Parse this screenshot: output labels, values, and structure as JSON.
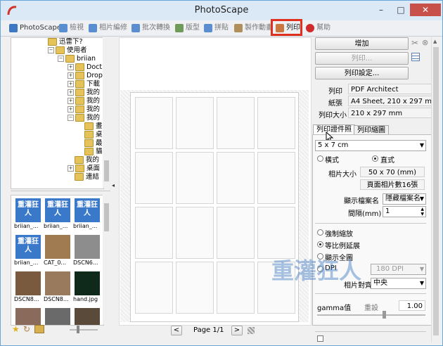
{
  "window": {
    "title": "PhotoScape",
    "minimize": "–",
    "maximize": "□",
    "close": "✕"
  },
  "toolbar_tabs": [
    {
      "label": "PhotoScape",
      "color": "#3d78c2"
    },
    {
      "label": "檢視",
      "color": "#5a8ed0"
    },
    {
      "label": "相片編修",
      "color": "#5a8ed0"
    },
    {
      "label": "批次轉換",
      "color": "#5a8ed0"
    },
    {
      "label": "版型",
      "color": "#6f9a5a"
    },
    {
      "label": "拼貼",
      "color": "#5a8ed0"
    },
    {
      "label": "製作動畫",
      "color": "#b0905a"
    },
    {
      "label": "列印",
      "color": "#c87840"
    },
    {
      "label": "幫助",
      "color": "#d12a2a"
    }
  ],
  "tree": {
    "items": [
      {
        "label": "迅雷下?",
        "pm": ""
      },
      {
        "label": "使用者",
        "pm": "−"
      },
      {
        "label": "briian",
        "pm": "−"
      },
      {
        "label": "Doct",
        "pm": "+"
      },
      {
        "label": "Drop",
        "pm": "+"
      },
      {
        "label": "下載",
        "pm": "+"
      },
      {
        "label": "我的",
        "pm": "+"
      },
      {
        "label": "我的",
        "pm": "+"
      },
      {
        "label": "我的",
        "pm": "+"
      },
      {
        "label": "我的",
        "pm": "−"
      },
      {
        "label": "畫",
        "pm": ""
      },
      {
        "label": "桌",
        "pm": ""
      },
      {
        "label": "最",
        "pm": ""
      },
      {
        "label": "貓",
        "pm": ""
      },
      {
        "label": "我的",
        "pm": ""
      },
      {
        "label": "桌面",
        "pm": "+"
      },
      {
        "label": "連結",
        "pm": ""
      }
    ]
  },
  "thumbnails": [
    {
      "caption": "briian_...",
      "kind": "logo",
      "text": "重灌狂人"
    },
    {
      "caption": "briian_...",
      "kind": "logo",
      "text": "重灌狂人"
    },
    {
      "caption": "briian_...",
      "kind": "logo",
      "text": "重灌狂人"
    },
    {
      "caption": "briian_...",
      "kind": "logo",
      "text": "重灌狂人"
    },
    {
      "caption": "CAT_0...",
      "kind": "photo",
      "color": "#a07a50"
    },
    {
      "caption": "DSCN6...",
      "kind": "photo",
      "color": "#8d8d8d"
    },
    {
      "caption": "DSCN8...",
      "kind": "photo",
      "color": "#7a5a3e"
    },
    {
      "caption": "DSCN8...",
      "kind": "photo",
      "color": "#9a7a5c"
    },
    {
      "caption": "hand.jpg",
      "kind": "photo",
      "color": "#0f2a1a"
    }
  ],
  "pagebar": {
    "prev": "<",
    "page_label": "Page 1/1",
    "next": ">"
  },
  "right": {
    "add_button": "增加",
    "print_button": "列印...",
    "print_settings_button": "列印設定...",
    "printer_label": "列印",
    "printer_value": "PDF Architect",
    "paper_label": "紙張",
    "paper_value": "A4 Sheet, 210 x 297 mm",
    "print_size_label": "列印大小",
    "print_size_value": "210 x 297 mm",
    "tab_photo": "列印證件照",
    "tab_layout": "列印縮圖",
    "size_select": "5 x 7 cm",
    "landscape": "橫式",
    "portrait": "直式",
    "photo_size_label": "相片大小",
    "photo_size_value": "50 x 70 (mm)",
    "per_page_value": "頁面相片數16張",
    "show_filename_label": "顯示檔案名",
    "show_filename_value": "隱藏檔案名",
    "spacing_label": "間隔(mm)",
    "spacing_value": "1",
    "opt_force": "強制縮放",
    "opt_ratio": "等比例延展",
    "opt_full": "顯示全圖",
    "opt_dpi": "DPI",
    "dpi_value": "180 DPI",
    "align_label": "相片對齊",
    "align_value": "中央",
    "gamma_label": "gamma值",
    "gamma_reset": "重設",
    "gamma_value": "1.00"
  },
  "watermark": "重灌狂人"
}
